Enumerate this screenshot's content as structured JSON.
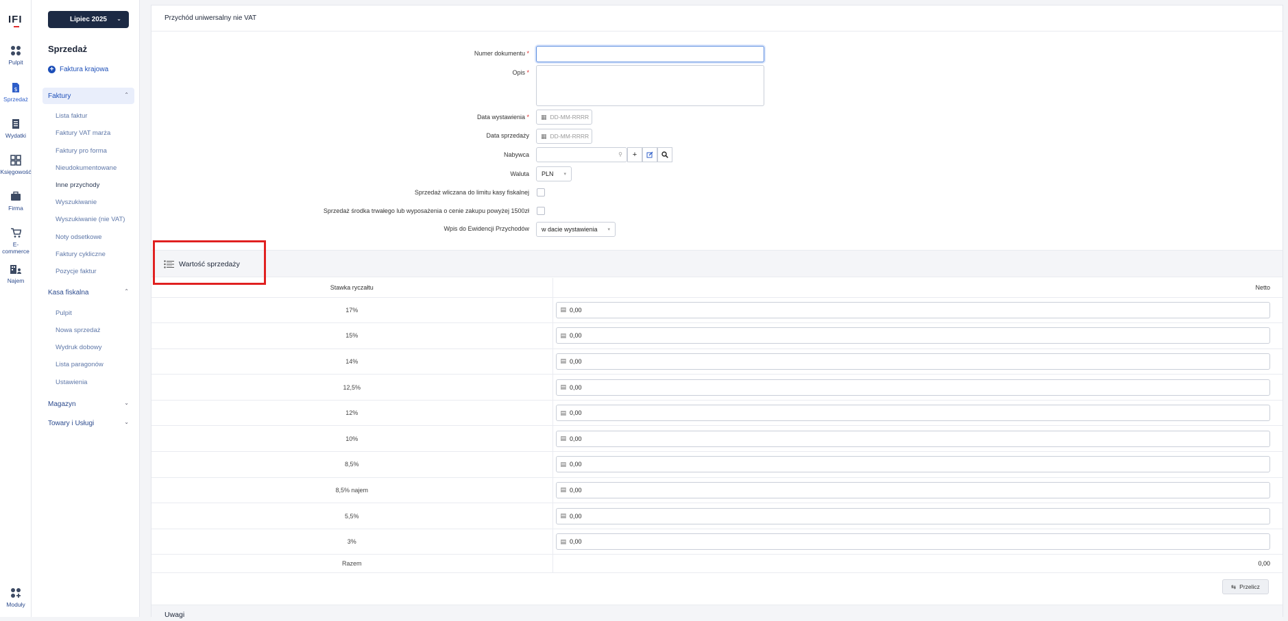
{
  "app": {
    "logo_text": "IFI"
  },
  "rail": [
    {
      "label": "Pulpit",
      "icon": "dashboard-icon"
    },
    {
      "label": "Sprzedaż",
      "icon": "sales-icon"
    },
    {
      "label": "Wydatki",
      "icon": "expenses-icon"
    },
    {
      "label": "Księgowość",
      "icon": "accounting-icon"
    },
    {
      "label": "Firma",
      "icon": "briefcase-icon"
    },
    {
      "label": "E-commerce",
      "icon": "cart-icon"
    },
    {
      "label": "Najem",
      "icon": "rental-icon"
    },
    {
      "label": "Moduły",
      "icon": "modules-icon"
    }
  ],
  "period": {
    "label": "Lipiec 2025"
  },
  "sidenav": {
    "title": "Sprzedaż",
    "add_invoice": "Faktura krajowa",
    "groups": {
      "faktury": {
        "label": "Faktury",
        "items": [
          "Lista faktur",
          "Faktury VAT marża",
          "Faktury pro forma",
          "Nieudokumentowane",
          "Inne przychody",
          "Wyszukiwanie",
          "Wyszukiwanie (nie VAT)",
          "Noty odsetkowe",
          "Faktury cykliczne",
          "Pozycje faktur"
        ]
      },
      "kasa": {
        "label": "Kasa fiskalna",
        "items": [
          "Pulpit",
          "Nowa sprzedaż",
          "Wydruk dobowy",
          "Lista paragonów",
          "Ustawienia"
        ]
      },
      "magazyn": {
        "label": "Magazyn"
      },
      "towary": {
        "label": "Towary i Usługi"
      }
    }
  },
  "panel": {
    "title": "Przychód uniwersalny nie VAT"
  },
  "form": {
    "doc_number_label": "Numer dokumentu",
    "doc_number_value": "",
    "description_label": "Opis",
    "description_value": "",
    "issue_date_label": "Data wystawienia",
    "sale_date_label": "Data sprzedaży",
    "date_placeholder": "DD-MM-RRRR",
    "buyer_label": "Nabywca",
    "buyer_value": "",
    "currency_label": "Waluta",
    "currency_value": "PLN",
    "fiscal_limit_label": "Sprzedaż wliczana do limitu kasy fiskalnej",
    "fixed_asset_label": "Sprzedaż środka trwałego lub wyposażenia o cenie zakupu powyżej 1500zł",
    "register_entry_label": "Wpis do Ewidencji Przychodów",
    "register_entry_value": "w dacie wystawienia",
    "required_mark": "*"
  },
  "sales_value": {
    "title": "Wartość sprzedaży",
    "col_rate": "Stawka ryczałtu",
    "col_net": "Netto",
    "rows": [
      {
        "rate": "17%",
        "net": "0,00"
      },
      {
        "rate": "15%",
        "net": "0,00"
      },
      {
        "rate": "14%",
        "net": "0,00"
      },
      {
        "rate": "12,5%",
        "net": "0,00"
      },
      {
        "rate": "12%",
        "net": "0,00"
      },
      {
        "rate": "10%",
        "net": "0,00"
      },
      {
        "rate": "8,5%",
        "net": "0,00"
      },
      {
        "rate": "8,5% najem",
        "net": "0,00"
      },
      {
        "rate": "5,5%",
        "net": "0,00"
      },
      {
        "rate": "3%",
        "net": "0,00"
      }
    ],
    "sum_label": "Razem",
    "sum_value": "0,00",
    "recalc_label": "Przelicz"
  },
  "notes": {
    "title": "Uwagi"
  },
  "colors": {
    "accent": "#1d4fb8",
    "dark": "#1c2a44",
    "highlight": "#e02020"
  }
}
